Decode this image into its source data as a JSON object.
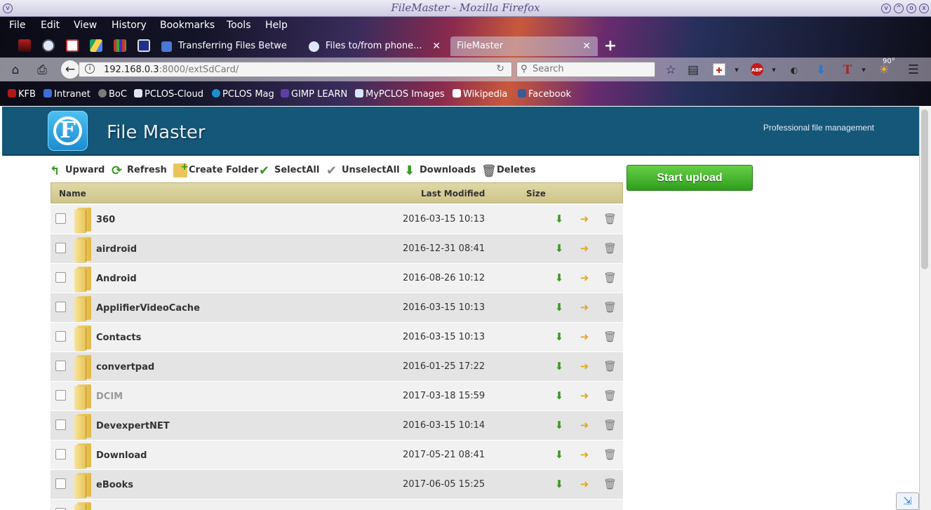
{
  "window": {
    "title": "FileMaster - Mozilla Firefox"
  },
  "menubar": {
    "items": [
      "File",
      "Edit",
      "View",
      "History",
      "Bookmarks",
      "Tools",
      "Help"
    ]
  },
  "tabs": [
    {
      "label": "Transferring Files Betwe",
      "active": false
    },
    {
      "label": "Files to/from phone...",
      "active": false
    },
    {
      "label": "FileMaster",
      "active": true
    }
  ],
  "navbar": {
    "url_host": "192.168.0.3",
    "url_path": ":8000/extSdCard/",
    "search_placeholder": "Search",
    "weather_temp": "90°"
  },
  "bookmarks": [
    {
      "label": "KFB",
      "color": "#b01818"
    },
    {
      "label": "Intranet",
      "color": "#3a6fd8"
    },
    {
      "label": "BoC",
      "color": "#7a7a7a"
    },
    {
      "label": "PCLOS-Cloud",
      "color": "#dfe6ef"
    },
    {
      "label": "PCLOS Mag",
      "color": "#1d8fcc"
    },
    {
      "label": "GIMP LEARN",
      "color": "#5b3fa6"
    },
    {
      "label": "MyPCLOS Images",
      "color": "#d8e6ff"
    },
    {
      "label": "Wikipedia",
      "color": "#ffffff"
    },
    {
      "label": "Facebook",
      "color": "#3b5998"
    }
  ],
  "app": {
    "logo_letter": "F",
    "brand": "File Master",
    "tagline": "Professional file management",
    "start_upload": "Start upload"
  },
  "toolbar": {
    "upward": "Upward",
    "refresh": "Refresh",
    "create_folder": "Create Folder",
    "select_all": "SelectAll",
    "unselect_all": "UnselectAll",
    "downloads": "Downloads",
    "deletes": "Deletes"
  },
  "table": {
    "columns": {
      "name": "Name",
      "modified": "Last Modified",
      "size": "Size"
    },
    "rows": [
      {
        "name": "360",
        "modified": "2016-03-15 10:13"
      },
      {
        "name": "airdroid",
        "modified": "2016-12-31 08:41"
      },
      {
        "name": "Android",
        "modified": "2016-08-26 10:12"
      },
      {
        "name": "ApplifierVideoCache",
        "modified": "2016-03-15 10:13"
      },
      {
        "name": "Contacts",
        "modified": "2016-03-15 10:13"
      },
      {
        "name": "convertpad",
        "modified": "2016-01-25 17:22"
      },
      {
        "name": "DCIM",
        "modified": "2017-03-18 15:59"
      },
      {
        "name": "DevexpertNET",
        "modified": "2016-03-15 10:14"
      },
      {
        "name": "Download",
        "modified": "2017-05-21 08:41"
      },
      {
        "name": "eBooks",
        "modified": "2017-06-05 15:25"
      }
    ]
  }
}
